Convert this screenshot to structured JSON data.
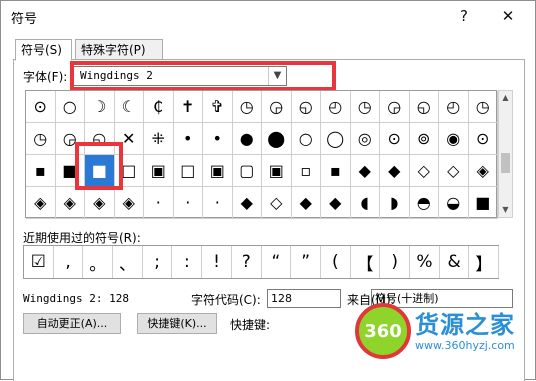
{
  "window": {
    "title": "符号",
    "help_glyph": "?",
    "close_glyph": "✕"
  },
  "tabs": [
    {
      "label": "符号(S)",
      "active": true
    },
    {
      "label": "特殊字符(P)",
      "active": false
    }
  ],
  "font": {
    "label": "字体(F):",
    "value": "Wingdings 2"
  },
  "symbols": [
    [
      "⊙",
      "○",
      "☽",
      "☾",
      "₵",
      "✝",
      "✞",
      "◷",
      "◶",
      "◵",
      "◴",
      "◷",
      "◶",
      "◵",
      "◴",
      "◷"
    ],
    [
      "◷",
      "◶",
      "◵",
      "✕",
      "⁜",
      "•",
      "•",
      "●",
      "⬤",
      "○",
      "◯",
      "◎",
      "⊙",
      "⊚",
      "◉",
      "⊙"
    ],
    [
      "▪",
      "■",
      "■",
      "□",
      "▣",
      "□",
      "▣",
      "▢",
      "▣",
      "▫",
      "▪",
      "◆",
      "◆",
      "◇",
      "◇",
      "◈"
    ],
    [
      "◈",
      "◈",
      "◈",
      "◈",
      "·",
      "·",
      "·",
      "◆",
      "◇",
      "◆",
      "◆",
      "◖",
      "◗",
      "◓",
      "◒",
      "■"
    ]
  ],
  "selected_symbol": {
    "row": 2,
    "col": 2
  },
  "recent": {
    "label": "近期使用过的符号(R):",
    "items": [
      "☑",
      ",",
      "。",
      "、",
      ";",
      ":",
      "!",
      "?",
      "“",
      "”",
      "(",
      "【",
      ")",
      "%",
      "&",
      "】"
    ]
  },
  "status_text": "Wingdings 2: 128",
  "char_code": {
    "label": "字符代码(C):",
    "value": "128"
  },
  "from": {
    "label": "来自(M):",
    "value": "符号(十进制)"
  },
  "buttons": {
    "autocorrect": "自动更正(A)...",
    "shortcut_key": "快捷键(K)..."
  },
  "shortcut_label": "快捷键:",
  "watermark": {
    "badge": "360",
    "text": "货源之家",
    "url": "www.360hyzj.com"
  },
  "colors": {
    "highlight": "#e8363c",
    "selection": "#2a7ad5"
  }
}
